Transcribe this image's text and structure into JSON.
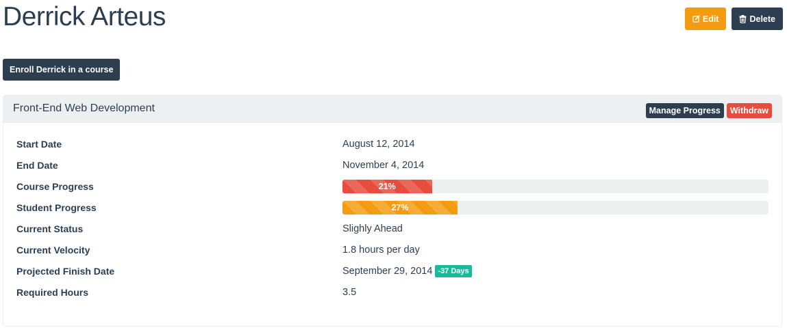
{
  "header": {
    "title": "Derrick Arteus",
    "edit_label": "Edit",
    "delete_label": "Delete"
  },
  "enroll_label": "Enroll Derrick in a course",
  "course": {
    "title": "Front-End Web Development",
    "manage_label": "Manage Progress",
    "withdraw_label": "Withdraw",
    "rows": {
      "start_date": {
        "label": "Start Date",
        "value": "August 12, 2014"
      },
      "end_date": {
        "label": "End Date",
        "value": "November 4, 2014"
      },
      "course_progress": {
        "label": "Course Progress",
        "value": "21%",
        "percent": 21,
        "color": "#e74c3c"
      },
      "student_progress": {
        "label": "Student Progress",
        "value": "27%",
        "percent": 27,
        "color": "#f39c12"
      },
      "current_status": {
        "label": "Current Status",
        "value": "Slighly Ahead"
      },
      "current_velocity": {
        "label": "Current Velocity",
        "value": "1.8 hours per day"
      },
      "projected_finish": {
        "label": "Projected Finish Date",
        "value": "September 29, 2014",
        "badge": "-37 Days",
        "badge_color": "#18bc9c"
      },
      "required_hours": {
        "label": "Required Hours",
        "value": "3.5"
      }
    }
  },
  "icons": {
    "edit": "edit-icon",
    "delete": "trash-icon"
  },
  "colors": {
    "primary": "#2c3e50",
    "warning": "#f39c12",
    "danger": "#e74c3c",
    "success": "#18bc9c",
    "panel_bg": "#ecf0f1"
  }
}
